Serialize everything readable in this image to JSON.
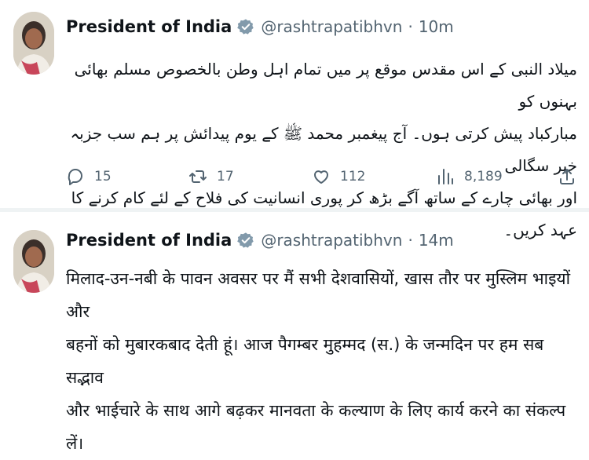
{
  "tweets": [
    {
      "author": {
        "name": "President of India",
        "handle": "@rashtrapatibhvn"
      },
      "separator": "·",
      "time": "10m",
      "text_lines": [
        "میلاد النبی کے اس مقدس موقع پر میں تمام اہل وطن بالخصوص مسلم بھائی بہنوں کو",
        "مبارکباد پیش کرتی ہوں۔ آج پیغمبر محمد ﷺ کے یوم پیدائش پر ہم سب جزبہ خیر سگالی",
        "اور بھائی چارے کے ساتھ آگے بڑھ کر پوری انسانیت کی فلاح کے لئے کام کرنے کا عہد کریں۔"
      ],
      "stats": {
        "replies": "15",
        "retweets": "17",
        "likes": "112",
        "views": "8,189"
      }
    },
    {
      "author": {
        "name": "President of India",
        "handle": "@rashtrapatibhvn"
      },
      "separator": "·",
      "time": "14m",
      "text_lines": [
        "मिलाद-उन-नबी के पावन अवसर पर मैं सभी देशवासियों, खास तौर पर मुस्लिम भाइयों और",
        "बहनों को  मुबारकबाद देती हूं। आज पैगम्बर मुहम्मद (स.) के जन्मदिन पर हम सब सद्भाव",
        "और भाईचारे के साथ आगे बढ़कर मानवता के कल्याण के लिए कार्य करने का संकल्प लें।"
      ]
    }
  ],
  "icons": {
    "verified": "verified-badge-icon",
    "reply": "reply-icon",
    "retweet": "retweet-icon",
    "like": "heart-icon",
    "views": "views-chart-icon",
    "share": "share-icon"
  },
  "colors": {
    "text": "#0f1419",
    "secondary": "#536471",
    "verified": "#829aab",
    "divider": "#eff3f4"
  }
}
